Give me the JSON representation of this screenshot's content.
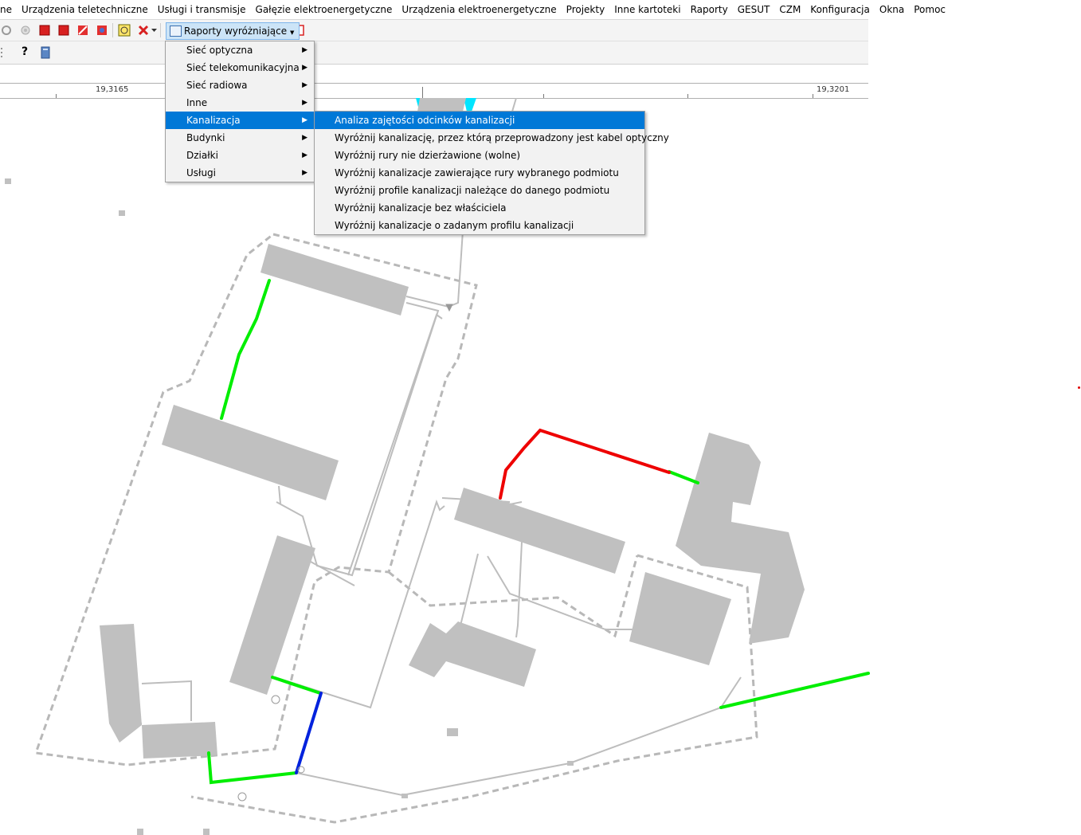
{
  "menubar": {
    "items": [
      "ne",
      "Urządzenia teletechniczne",
      "Usługi i transmisje",
      "Gałęzie elektroenergetyczne",
      "Urządzenia elektroenergetyczne",
      "Projekty",
      "Inne kartoteki",
      "Raporty",
      "GESUT",
      "CZM",
      "Konfiguracja",
      "Okna",
      "Pomoc"
    ]
  },
  "toolbar": {
    "reports_button_label": "Raporty wyróżniające",
    "help_label": "?"
  },
  "ruler": {
    "left_label": "19,3165",
    "right_label": "19,3201"
  },
  "reports_menu": {
    "items": [
      {
        "label": "Sieć optyczna"
      },
      {
        "label": "Sieć telekomunikacyjna"
      },
      {
        "label": "Sieć radiowa"
      },
      {
        "label": "Inne"
      },
      {
        "label": "Kanalizacja"
      },
      {
        "label": "Budynki"
      },
      {
        "label": "Działki"
      },
      {
        "label": "Usługi"
      }
    ],
    "highlighted_index": 4
  },
  "kanalizacja_submenu": {
    "items": [
      {
        "label": "Analiza zajętości odcinków kanalizacji"
      },
      {
        "label": "Wyróżnij kanalizację, przez którą przeprowadzony jest kabel optyczny"
      },
      {
        "label": "Wyróżnij rury nie dzierżawione (wolne)"
      },
      {
        "label": "Wyróżnij kanalizacje zawierające rury wybranego podmiotu"
      },
      {
        "label": "Wyróżnij profile kanalizacji należące do danego podmiotu"
      },
      {
        "label": "Wyróżnij kanalizacje bez właściciela"
      },
      {
        "label": "Wyróżnij kanalizacje o zadanym profilu kanalizacji"
      }
    ],
    "highlighted_index": 0
  },
  "map": {
    "colors": {
      "building": "#c0c0c0",
      "parcel_dash": "#b8b8b8",
      "duct_free": "#00ee00",
      "duct_occupied": "#ee0000",
      "duct_other": "#0022dd",
      "line": "#bdbdbd"
    }
  }
}
